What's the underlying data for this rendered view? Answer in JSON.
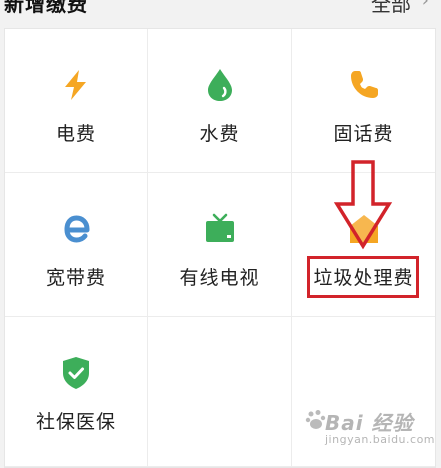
{
  "header": {
    "left_title": "新增缴费",
    "right_link": "全部",
    "right_chevron_icon": "chevron-right-icon"
  },
  "services": [
    {
      "label": "电费",
      "icon": "lightning-icon",
      "color": "#f5a623"
    },
    {
      "label": "水费",
      "icon": "water-drop-icon",
      "color": "#3dae5a"
    },
    {
      "label": "固话费",
      "icon": "telephone-icon",
      "color": "#f5a623"
    },
    {
      "label": "宽带费",
      "icon": "broadband-e-icon",
      "color": "#4a8fd0"
    },
    {
      "label": "有线电视",
      "icon": "tv-icon",
      "color": "#3dae5a"
    },
    {
      "label": "垃圾处理费",
      "icon": "house-icon",
      "color": "#f5a623"
    },
    {
      "label": "社保医保",
      "icon": "shield-check-icon",
      "color": "#3dae5a"
    }
  ],
  "annotation": {
    "highlight_color": "#d2232a",
    "arrow_icon": "arrow-down-icon"
  },
  "watermark": {
    "main": "Bai 经验",
    "sub": "jingyan.baidu.com"
  }
}
